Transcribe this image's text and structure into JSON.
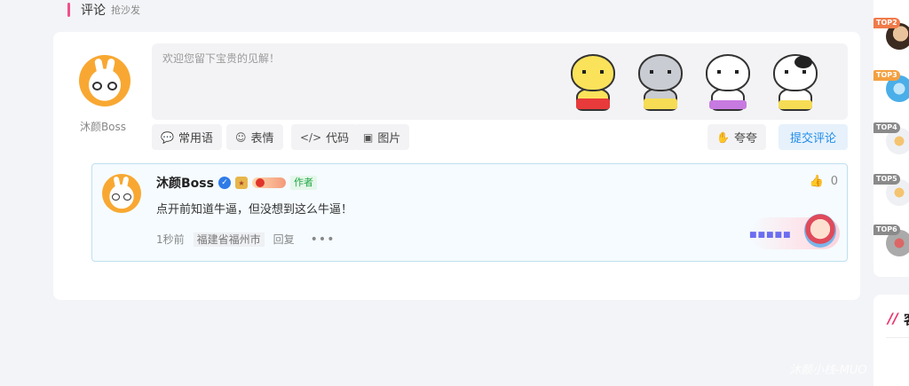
{
  "section": {
    "title": "评论",
    "subtitle": "抢沙发"
  },
  "me": {
    "name": "沐颜Boss"
  },
  "editor": {
    "placeholder": "欢迎您留下宝贵的见解！"
  },
  "toolbar": {
    "common_label": "常用语",
    "emoji_label": "表情",
    "code_label": "代码",
    "image_label": "图片",
    "praise_label": "夸夸",
    "submit_label": "提交评论"
  },
  "comment": {
    "author": "沐颜Boss",
    "author_badge": "作者",
    "text": "点开前知道牛逼，但没想到这么牛逼！",
    "time": "1秒前",
    "location": "福建省福州市",
    "reply_label": "回复",
    "likes": "0",
    "deco_text": "■■■■■"
  },
  "ranks": [
    {
      "tag": "TOP2",
      "color": "#f07a4a"
    },
    {
      "tag": "TOP3",
      "color": "#f4a040"
    },
    {
      "tag": "TOP4",
      "color": "#8a8a8a"
    },
    {
      "tag": "TOP5",
      "color": "#8a8a8a"
    },
    {
      "tag": "TOP6",
      "color": "#8a8a8a"
    }
  ],
  "side_heading": "客",
  "watermark": "沐颜小栈-MUO",
  "colors": {
    "accent": "#f0508c",
    "primary": "#1f8ce8",
    "author_green": "#1fa845"
  }
}
